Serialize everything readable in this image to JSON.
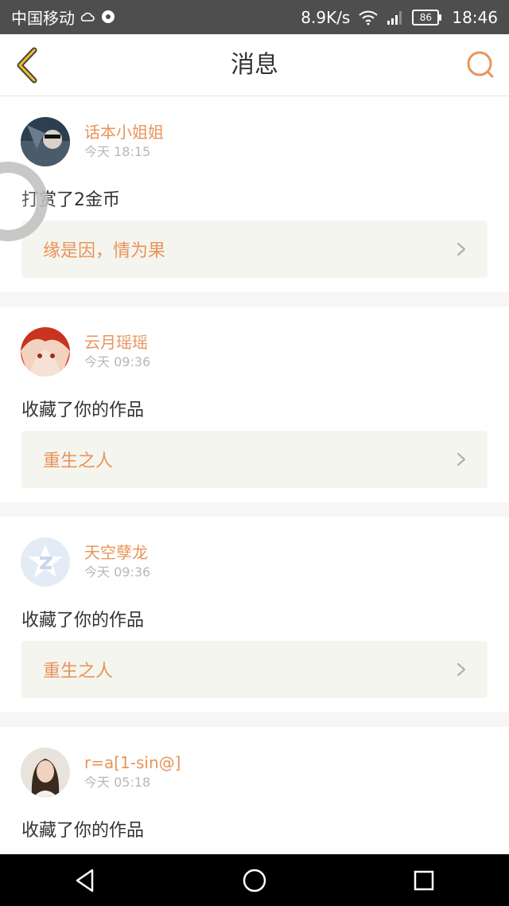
{
  "status_bar": {
    "carrier": "中国移动",
    "network_speed": "8.9K/s",
    "battery": "86",
    "time": "18:46"
  },
  "header": {
    "title": "消息",
    "accent_color": "#e8945a"
  },
  "messages": [
    {
      "username": "话本小姐姐",
      "time": "今天 18:15",
      "action": "打赏了2金币",
      "work": "缘是因，情为果",
      "avatar": "avatar-car-driver"
    },
    {
      "username": "云月瑶瑶",
      "time": "今天 09:36",
      "action": "收藏了你的作品",
      "work": "重生之人",
      "avatar": "avatar-anime-red-hair"
    },
    {
      "username": "天空孽龙",
      "time": "今天 09:36",
      "action": "收藏了你的作品",
      "work": "重生之人",
      "avatar": "avatar-default-star"
    },
    {
      "username": "r=a[1-sin@]",
      "time": "今天 05:18",
      "action": "收藏了你的作品",
      "work": "",
      "avatar": "avatar-woman-portrait"
    }
  ]
}
